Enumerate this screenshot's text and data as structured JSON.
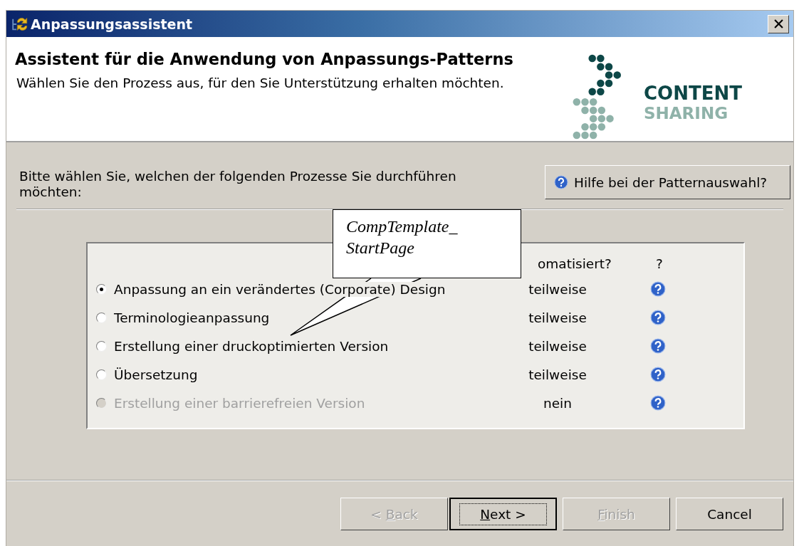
{
  "window": {
    "title": "Anpassungsassistent"
  },
  "header": {
    "title": "Assistent für die Anwendung von Anpassungs-Patterns",
    "subtitle": "Wählen Sie den Prozess aus, für den Sie Unterstützung erhalten möchten.",
    "logo": {
      "line_1": "CONTENT",
      "line_2": "SHARING"
    }
  },
  "prompt": "Bitte wählen Sie, welchen der folgenden Prozesse Sie durchführen möchten:",
  "help_button": {
    "label": "Hilfe bei der Patternauswahl?"
  },
  "table": {
    "columns": [
      "omatisiert?",
      "?"
    ],
    "options": [
      {
        "label": "Anpassung an ein verändertes (Corporate) Design",
        "automation": "teilweise",
        "selected": true,
        "disabled": false
      },
      {
        "label": "Terminologieanpassung",
        "automation": "teilweise",
        "selected": false,
        "disabled": false
      },
      {
        "label": "Erstellung einer druckoptimierten Version",
        "automation": "teilweise",
        "selected": false,
        "disabled": false
      },
      {
        "label": "Übersetzung",
        "automation": "teilweise",
        "selected": false,
        "disabled": false
      },
      {
        "label": "Erstellung einer barrierefreien Version",
        "automation": "nein",
        "selected": false,
        "disabled": true
      }
    ]
  },
  "callout": {
    "lines": [
      "CompTemplate_",
      "StartPage"
    ]
  },
  "buttons": [
    {
      "before": "< ",
      "mnemonic": "B",
      "after": "ack",
      "disabled": true,
      "default": false
    },
    {
      "mnemonic": "N",
      "after": "ext >",
      "disabled": false,
      "default": true
    },
    {
      "mnemonic": "F",
      "after": "inish",
      "disabled": true,
      "default": false
    },
    {
      "before": "Cancel",
      "disabled": false,
      "default": false
    }
  ]
}
